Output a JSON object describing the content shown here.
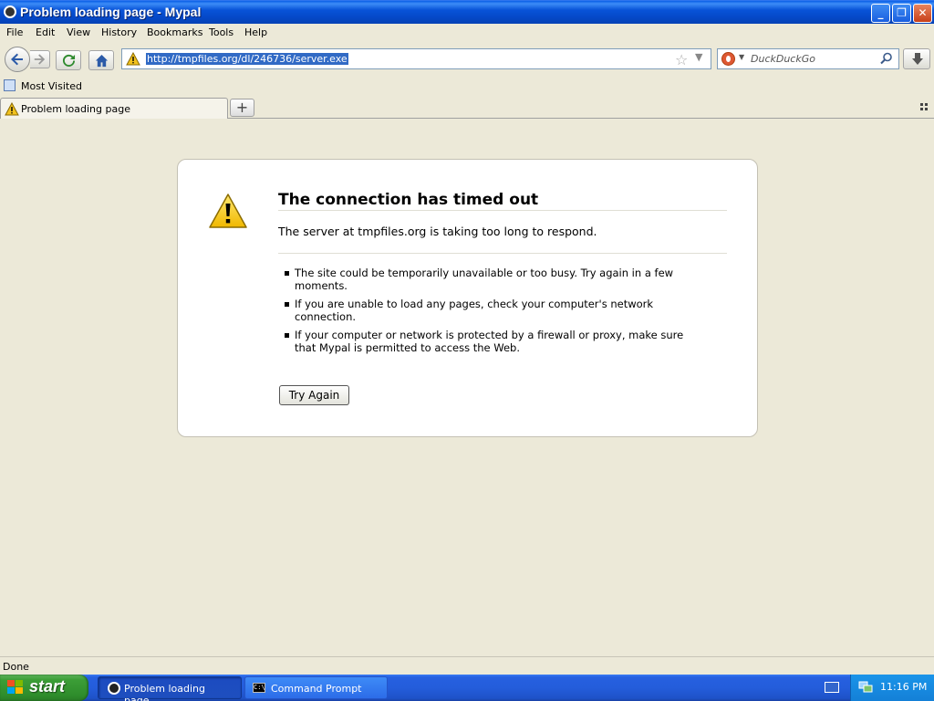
{
  "window": {
    "title": "Problem loading page - Mypal",
    "min_label": "_",
    "max_label": "❐",
    "close_label": "✕"
  },
  "menu": [
    "File",
    "Edit",
    "View",
    "History",
    "Bookmarks",
    "Tools",
    "Help"
  ],
  "navbar": {
    "url": "http://tmpfiles.org/dl/246736/server.exe",
    "search_placeholder": "DuckDuckGo"
  },
  "bookmarks": {
    "most_visited": "Most Visited"
  },
  "tabs": {
    "active_label": "Problem loading page",
    "new_tab_label": "+"
  },
  "error": {
    "title": "The connection has timed out",
    "description": "The server at tmpfiles.org is taking too long to respond.",
    "items": [
      "The site could be temporarily unavailable or too busy. Try again in a few moments.",
      "If you are unable to load any pages, check your computer's network connection.",
      "If your computer or network is protected by a firewall or proxy, make sure that Mypal is permitted to access the Web."
    ],
    "button": "Try Again"
  },
  "status": {
    "text": "Done"
  },
  "taskbar": {
    "start": "start",
    "tasks": [
      "Problem loading page...",
      "Command Prompt"
    ],
    "cmd_icon_text": "C:\\",
    "clock": "11:16 PM"
  },
  "colors": {
    "titlebar": "#0853d8",
    "taskbar": "#245ddb",
    "start": "#3c9e37",
    "page_bg": "#ece9d8",
    "selection": "#316ac5"
  }
}
